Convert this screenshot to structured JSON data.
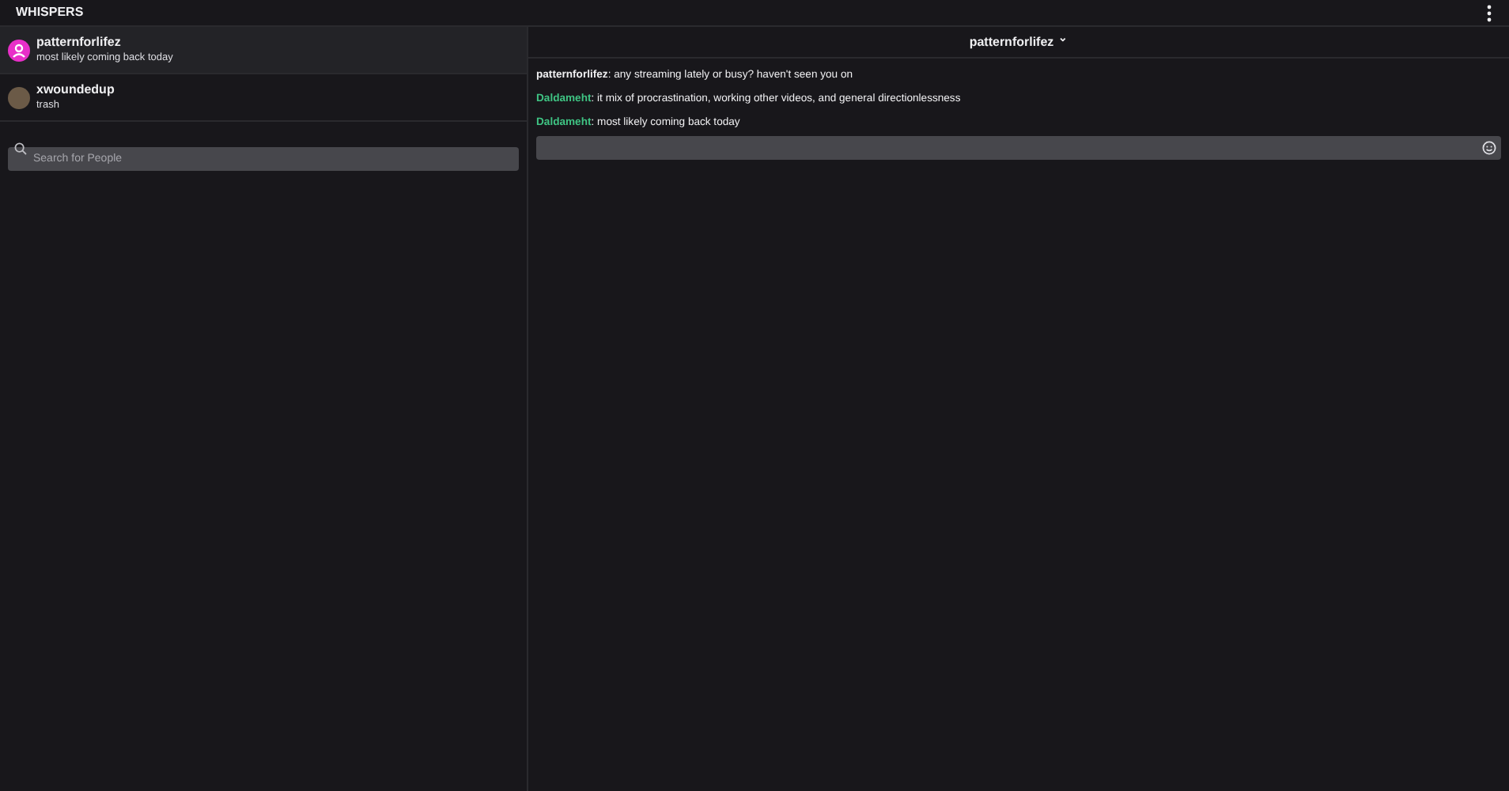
{
  "header": {
    "title": "WHISPERS"
  },
  "conversations": [
    {
      "name": "patternforlifez",
      "preview": "most likely coming back today",
      "kind": "default",
      "selected": true
    },
    {
      "name": "xwoundedup",
      "preview": "trash",
      "kind": "photo",
      "selected": false
    }
  ],
  "search": {
    "placeholder": "Search for People"
  },
  "chat": {
    "recipient": "patternforlifez",
    "caret": "⌄",
    "messages": [
      {
        "author": "patternforlifez",
        "text": ": any streaming lately or busy? haven't seen you on",
        "color": "#efeff1"
      },
      {
        "author": "Daldameht",
        "text": ": it mix of procrastination, working other videos, and general directionlessness",
        "color": "#3fc383"
      },
      {
        "author": "Daldameht",
        "text": ": most likely coming back today",
        "color": "#3fc383"
      }
    ]
  }
}
